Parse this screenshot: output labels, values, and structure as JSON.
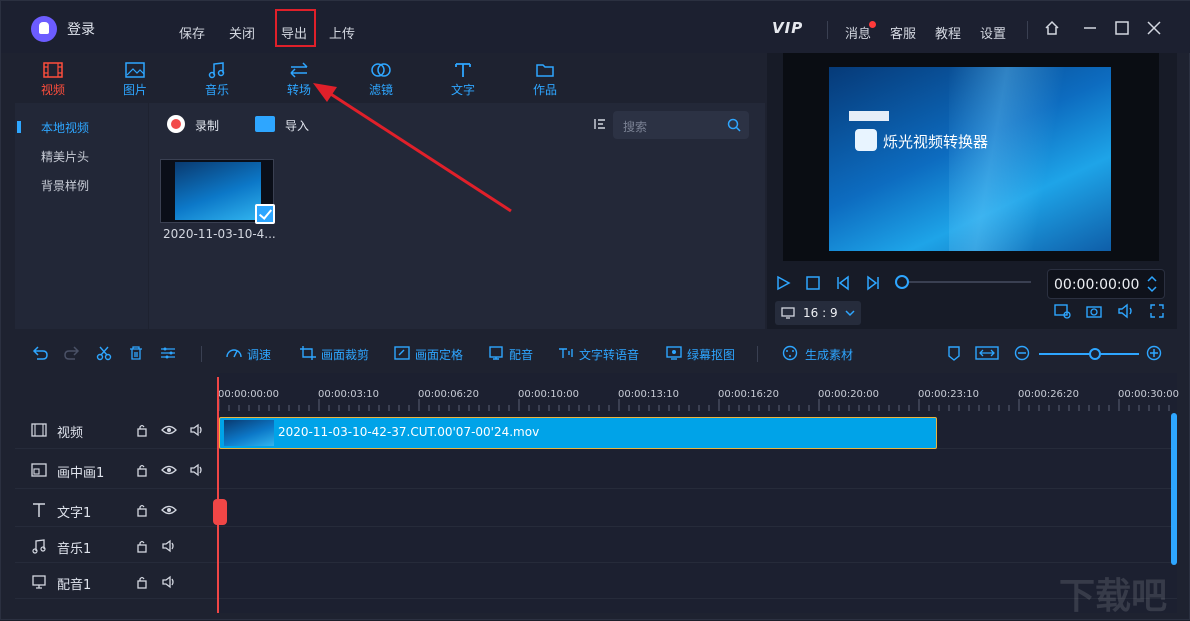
{
  "titlebar": {
    "login": "登录",
    "menu": [
      "保存",
      "关闭",
      "导出",
      "上传"
    ],
    "vip": "VIP",
    "right": [
      "消息",
      "客服",
      "教程",
      "设置"
    ]
  },
  "tabs": [
    {
      "label": "视频",
      "icon": "film-icon"
    },
    {
      "label": "图片",
      "icon": "image-icon"
    },
    {
      "label": "音乐",
      "icon": "music-icon"
    },
    {
      "label": "转场",
      "icon": "transition-icon"
    },
    {
      "label": "滤镜",
      "icon": "filter-icon"
    },
    {
      "label": "文字",
      "icon": "text-icon"
    },
    {
      "label": "作品",
      "icon": "folder-icon"
    }
  ],
  "sidenav": [
    "本地视频",
    "精美片头",
    "背景样例"
  ],
  "media": {
    "record": "录制",
    "import": "导入",
    "search_placeholder": "搜索",
    "item_name": "2020-11-03-10-4..."
  },
  "preview": {
    "title_text": "烁光视频转换器",
    "time": "00:00:00:00",
    "ratio": "16 : 9"
  },
  "edit_tools": [
    "调速",
    "画面裁剪",
    "画面定格",
    "配音",
    "文字转语音",
    "绿幕抠图",
    "生成素材"
  ],
  "ruler": [
    "00:00:00:00",
    "00:00:03:10",
    "00:00:06:20",
    "00:00:10:00",
    "00:00:13:10",
    "00:00:16:20",
    "00:00:20:00",
    "00:00:23:10",
    "00:00:26:20",
    "00:00:30:00"
  ],
  "tracks": [
    "视频",
    "画中画1",
    "文字1",
    "音乐1",
    "配音1"
  ],
  "clip": "2020-11-03-10-42-37.CUT.00'07-00'24.mov",
  "colors": {
    "accent": "#2ea6ff",
    "active_tab": "#ff4e3c",
    "annotation": "#e0202a",
    "clip": "#00a3e8"
  }
}
